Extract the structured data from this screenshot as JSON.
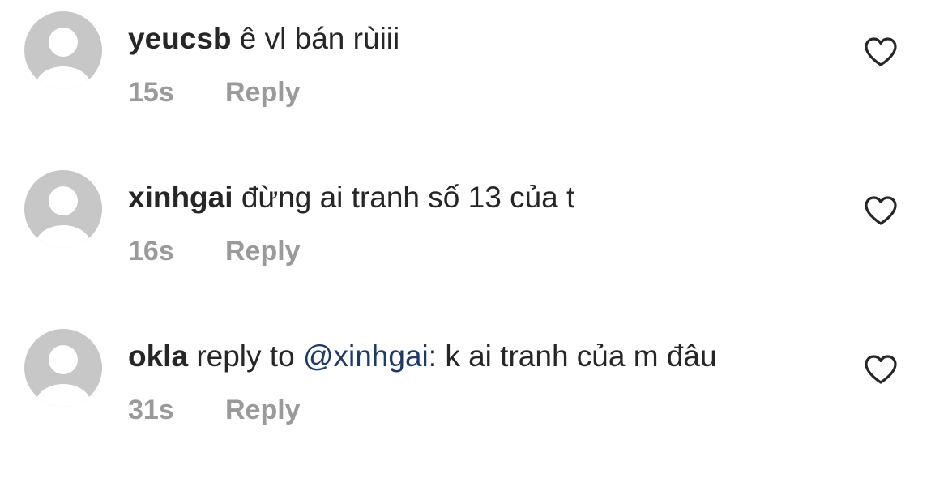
{
  "comments": [
    {
      "username": "yeucsb",
      "text": "ê vl bán rùiii",
      "time": "15s",
      "reply_label": "Reply"
    },
    {
      "username": "xinhgai",
      "text": "đừng ai tranh số 13 của t",
      "time": "16s",
      "reply_label": "Reply"
    },
    {
      "username": "okla",
      "prefix": "reply to",
      "mention": "@xinhgai",
      "text": ": k ai tranh của m đâu",
      "time": "31s",
      "reply_label": "Reply"
    }
  ],
  "icons": {
    "avatar": "default-avatar-icon",
    "like": "heart-outline-icon"
  },
  "colors": {
    "text": "#262626",
    "secondary": "#9a9a9a",
    "mention": "#1f3a67",
    "avatar_bg": "#c7c7c7",
    "avatar_fg": "#ffffff"
  }
}
